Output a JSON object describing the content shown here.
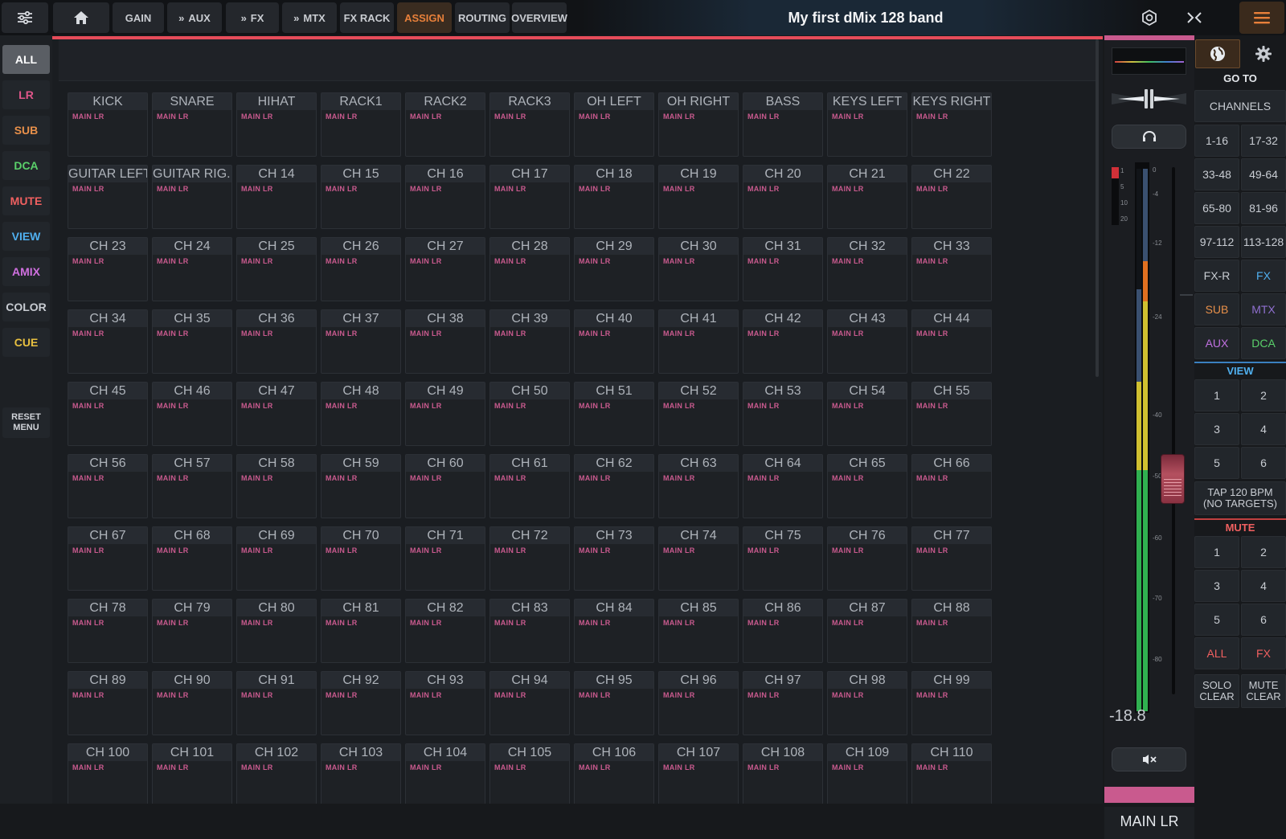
{
  "topbar": {
    "gain": "GAIN",
    "aux": "AUX",
    "fx": "FX",
    "mtx": "MTX",
    "fxrack": "FX RACK",
    "assign": "ASSIGN",
    "routing": "ROUTING",
    "overview": "OVERVIEW",
    "title": "My first dMix 128 band",
    "accent_color": "#e8803a"
  },
  "sidebar": {
    "items": [
      {
        "label": "ALL",
        "color": "#ffffff"
      },
      {
        "label": "LR",
        "color": "#e0568a"
      },
      {
        "label": "SUB",
        "color": "#e8904a"
      },
      {
        "label": "DCA",
        "color": "#5ad06a"
      },
      {
        "label": "MUTE",
        "color": "#f06060"
      },
      {
        "label": "VIEW",
        "color": "#50b0f0"
      },
      {
        "label": "AMIX",
        "color": "#d070e0"
      },
      {
        "label": "COLOR",
        "color": "#c8ccd2"
      },
      {
        "label": "CUE",
        "color": "#e8c040"
      }
    ],
    "reset_line1": "RESET",
    "reset_line2": "MENU"
  },
  "channels": [
    "KICK",
    "SNARE",
    "HIHAT",
    "RACK1",
    "RACK2",
    "RACK3",
    "OH LEFT",
    "OH RIGHT",
    "BASS",
    "KEYS LEFT",
    "KEYS RIGHT",
    "GUITAR LEFT",
    "GUITAR RIG..",
    "CH 14",
    "CH 15",
    "CH 16",
    "CH 17",
    "CH 18",
    "CH 19",
    "CH 20",
    "CH 21",
    "CH 22",
    "CH 23",
    "CH 24",
    "CH 25",
    "CH 26",
    "CH 27",
    "CH 28",
    "CH 29",
    "CH 30",
    "CH 31",
    "CH 32",
    "CH 33",
    "CH 34",
    "CH 35",
    "CH 36",
    "CH 37",
    "CH 38",
    "CH 39",
    "CH 40",
    "CH 41",
    "CH 42",
    "CH 43",
    "CH 44",
    "CH 45",
    "CH 46",
    "CH 47",
    "CH 48",
    "CH 49",
    "CH 50",
    "CH 51",
    "CH 52",
    "CH 53",
    "CH 54",
    "CH 55",
    "CH 56",
    "CH 57",
    "CH 58",
    "CH 59",
    "CH 60",
    "CH 61",
    "CH 62",
    "CH 63",
    "CH 64",
    "CH 65",
    "CH 66",
    "CH 67",
    "CH 68",
    "CH 69",
    "CH 70",
    "CH 71",
    "CH 72",
    "CH 73",
    "CH 74",
    "CH 75",
    "CH 76",
    "CH 77",
    "CH 78",
    "CH 79",
    "CH 80",
    "CH 81",
    "CH 82",
    "CH 83",
    "CH 84",
    "CH 85",
    "CH 86",
    "CH 87",
    "CH 88",
    "CH 89",
    "CH 90",
    "CH 91",
    "CH 92",
    "CH 93",
    "CH 94",
    "CH 95",
    "CH 96",
    "CH 97",
    "CH 98",
    "CH 99",
    "CH 100",
    "CH 101",
    "CH 102",
    "CH 103",
    "CH 104",
    "CH 105",
    "CH 106",
    "CH 107",
    "CH 108",
    "CH 109",
    "CH 110"
  ],
  "assign_label": "MAIN LR",
  "strip": {
    "gain_value": "-18.8",
    "name": "MAIN LR",
    "color": "#c95a8e",
    "gr_scale": [
      "1",
      "5",
      "10",
      "20"
    ],
    "scale": [
      "0",
      "-4",
      "-12",
      "-24",
      "-40",
      "-50",
      "-60",
      "-70",
      "-80"
    ]
  },
  "right_panel": {
    "goto": "GO TO",
    "channels": "CHANNELS",
    "ranges": [
      "1-16",
      "17-32",
      "33-48",
      "49-64",
      "65-80",
      "81-96",
      "97-112",
      "113-128"
    ],
    "fxr": "FX-R",
    "fx": "FX",
    "sub": "SUB",
    "mtx": "MTX",
    "aux": "AUX",
    "dca": "DCA",
    "view": "VIEW",
    "view_nums": [
      "1",
      "2",
      "3",
      "4",
      "5",
      "6"
    ],
    "tap_line1": "TAP 120 BPM",
    "tap_line2": "(NO TARGETS)",
    "mute": "MUTE",
    "mute_nums": [
      "1",
      "2",
      "3",
      "4",
      "5",
      "6"
    ],
    "all": "ALL",
    "fx2": "FX",
    "solo_line1": "SOLO",
    "solo_line2": "CLEAR",
    "mute_line1": "MUTE",
    "mute_line2": "CLEAR"
  }
}
